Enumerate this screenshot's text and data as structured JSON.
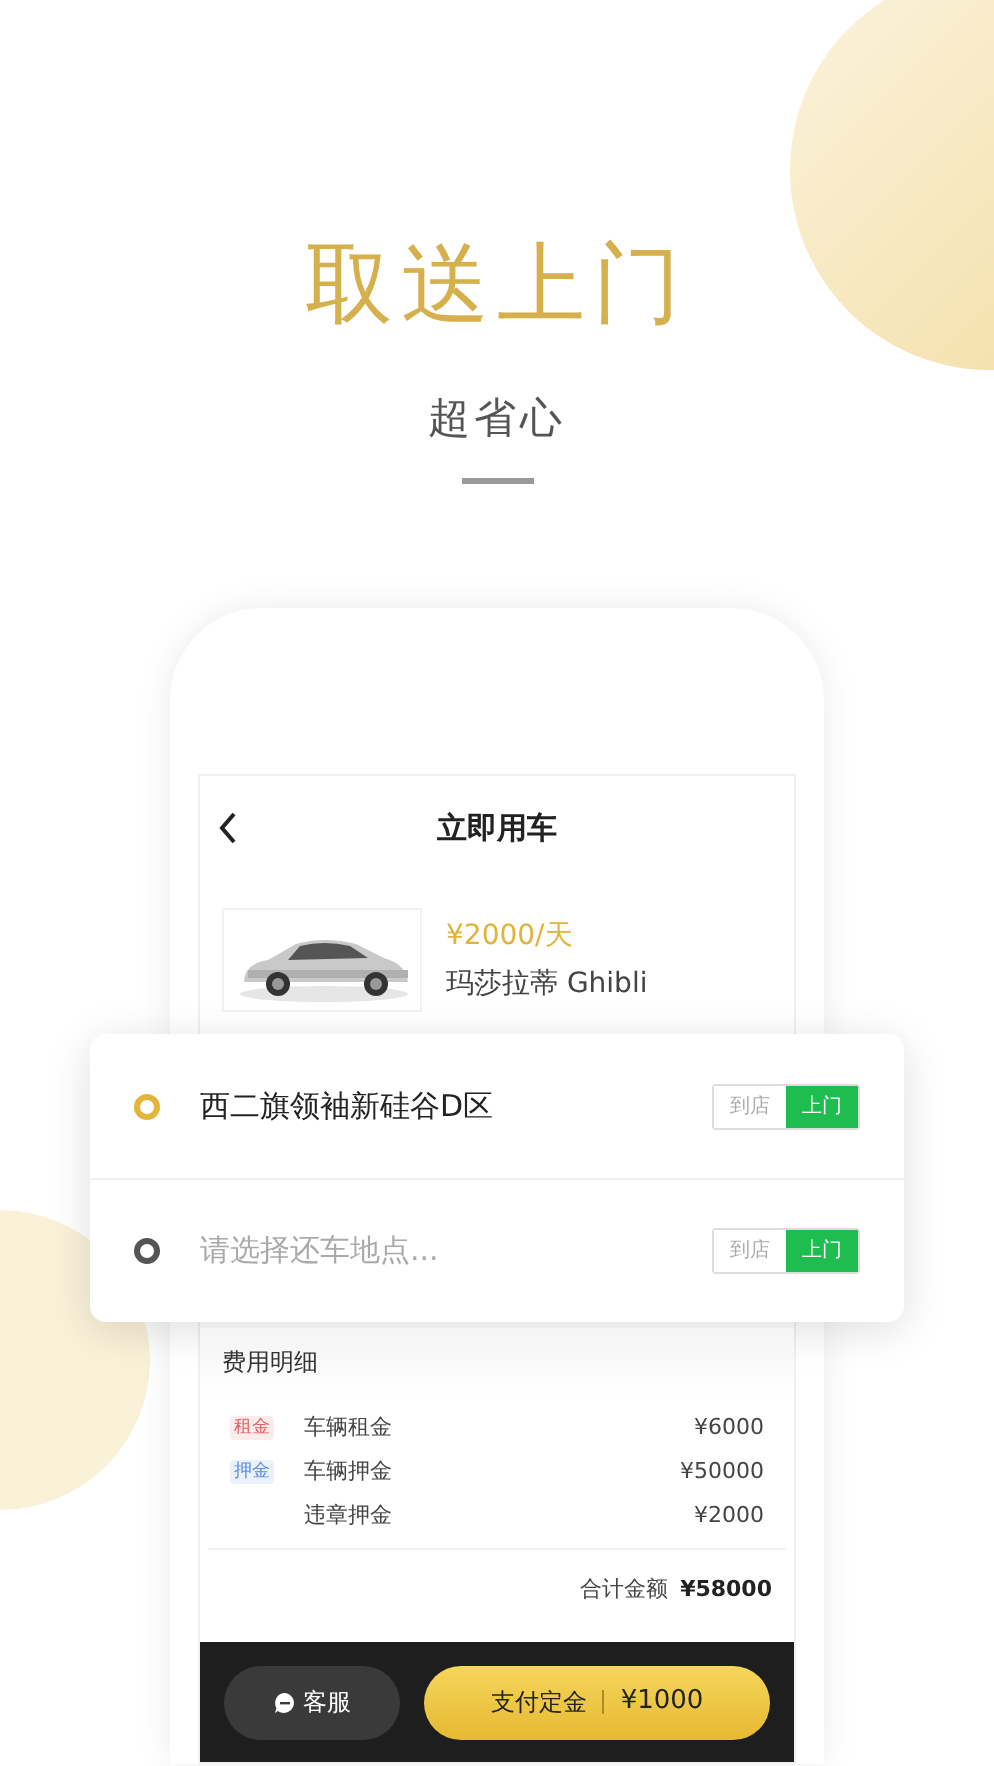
{
  "headline": "取送上门",
  "subtitle": "超省心",
  "screen": {
    "title": "立即用车",
    "car": {
      "price": "¥2000/天",
      "name": "玛莎拉蒂 Ghibli"
    }
  },
  "locations": [
    {
      "kind": "value",
      "text": "西二旗领袖新硅谷D区",
      "color": "#e3b53a",
      "options": [
        {
          "label": "到店",
          "selected": false
        },
        {
          "label": "上门",
          "selected": true
        }
      ]
    },
    {
      "kind": "placeholder",
      "placeholder": "请选择还车地点...",
      "color": "#555555",
      "options": [
        {
          "label": "到店",
          "selected": false
        },
        {
          "label": "上门",
          "selected": true
        }
      ]
    }
  ],
  "fees": {
    "title": "费用明细",
    "items": [
      {
        "tag": "租金",
        "color": "#e06060",
        "label": "车辆租金",
        "amount": "¥6000"
      },
      {
        "tag": "押金",
        "color": "#5b8de0",
        "label": "车辆押金",
        "amount": "¥50000"
      },
      {
        "label": "违章押金",
        "amount": "¥2000"
      }
    ],
    "total_label": "合计金额",
    "total": "¥58000"
  },
  "bottom": {
    "service": "客服",
    "pay_label": "支付定金",
    "pay_amount": "¥1000"
  }
}
